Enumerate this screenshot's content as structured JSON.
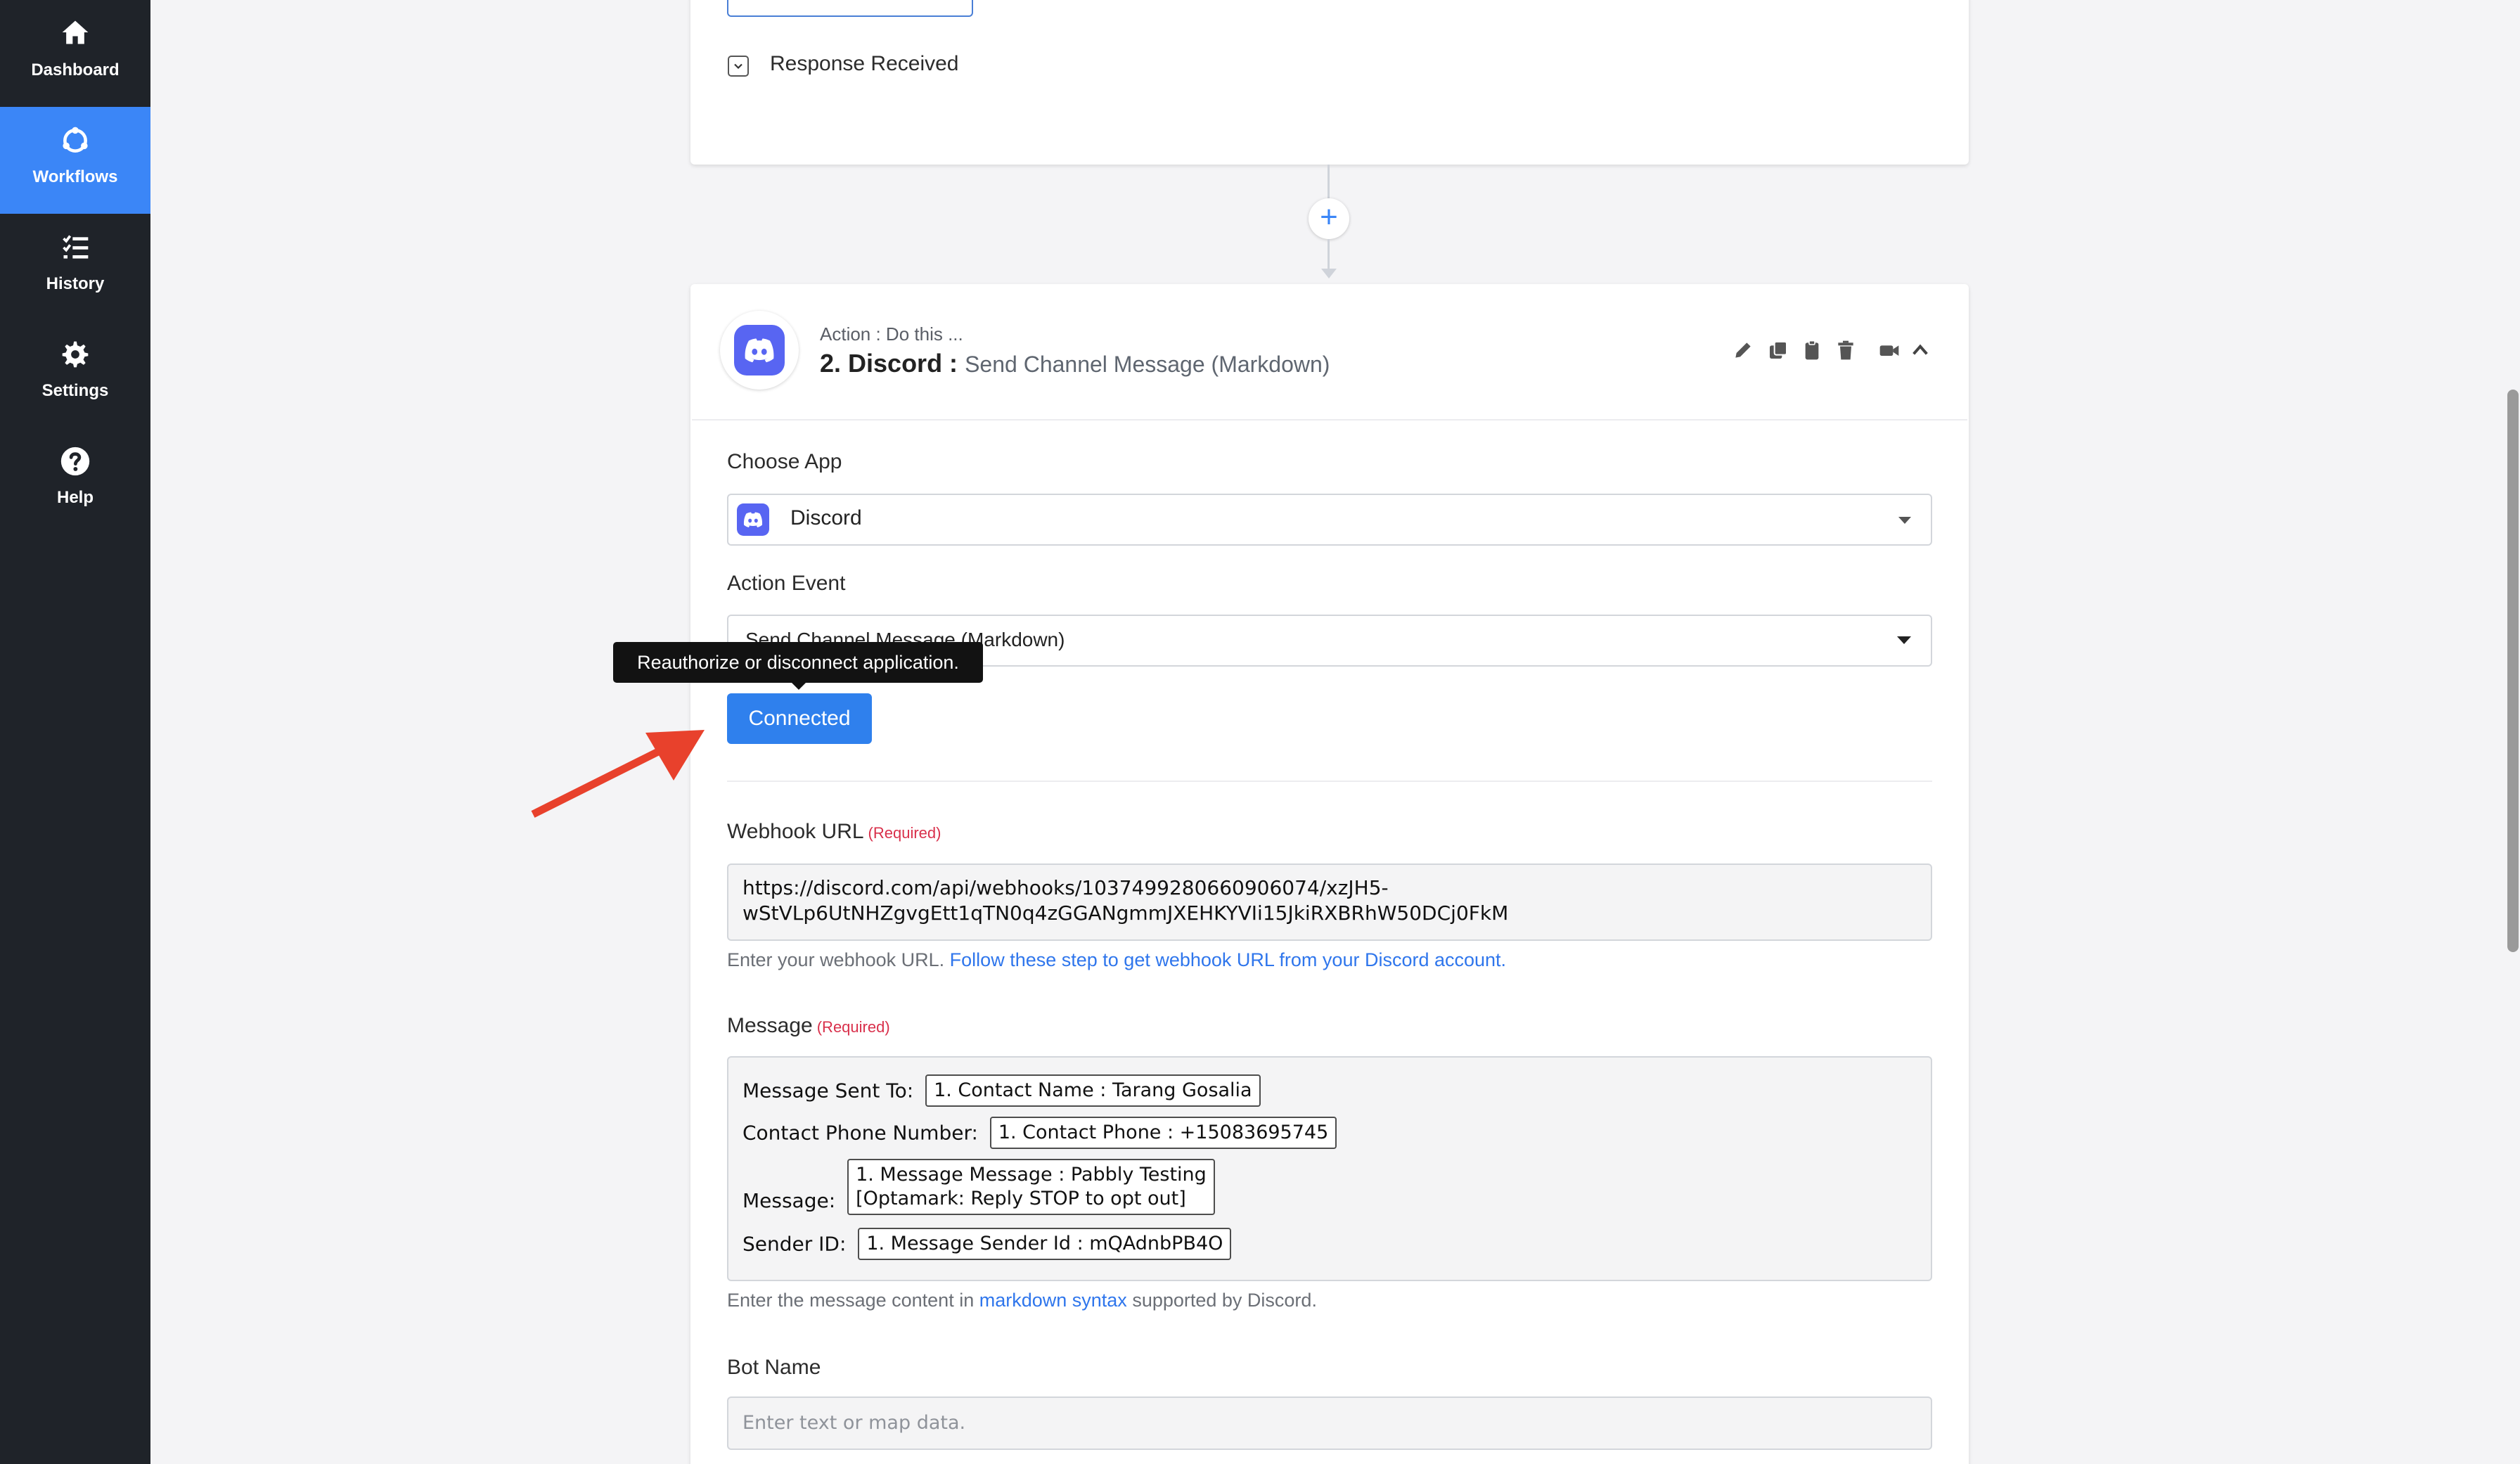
{
  "sidebar": {
    "items": [
      {
        "label": "Dashboard",
        "icon": "home-icon",
        "active": false
      },
      {
        "label": "Workflows",
        "icon": "workflows-icon",
        "active": true
      },
      {
        "label": "History",
        "icon": "history-icon",
        "active": false
      },
      {
        "label": "Settings",
        "icon": "gear-icon",
        "active": false
      },
      {
        "label": "Help",
        "icon": "help-icon",
        "active": false
      }
    ]
  },
  "trigger_card": {
    "response_received_label": "Response Received"
  },
  "action_card": {
    "subtitle": "Action : Do this ...",
    "step_title": "2. Discord :",
    "step_event": "Send Channel Message (Markdown)",
    "choose_app_label": "Choose App",
    "choose_app_value": "Discord",
    "action_event_label": "Action Event",
    "action_event_value": "Send Channel Message (Markdown)",
    "tooltip": "Reauthorize or disconnect application.",
    "connected_label": "Connected",
    "webhook": {
      "label": "Webhook URL",
      "required": "(Required)",
      "value_line1": "https://discord.com/api/webhooks/1037499280660906074/xzJH5-",
      "value_line2": "wStVLp6UtNHZgvgEtt1qTN0q4zGGANgmmJXEHKYVIi15JkiRXBRhW50DCj0FkM",
      "help_prefix": "Enter your webhook URL. ",
      "help_link": "Follow these step to get webhook URL from your Discord account."
    },
    "message": {
      "label": "Message",
      "required": "(Required)",
      "rows": [
        {
          "prefix": "Message Sent To:",
          "tag": "1. Contact Name : Tarang Gosalia"
        },
        {
          "prefix": "Contact Phone Number:",
          "tag": "1. Contact Phone : +15083695745"
        },
        {
          "prefix": "Message:",
          "tag_line1": "1. Message Message : Pabbly Testing",
          "tag_line2": "[Optamark: Reply STOP to opt out]"
        },
        {
          "prefix": "Sender ID:",
          "tag": "1. Message Sender Id : mQAdnbPB4O"
        }
      ],
      "help_prefix": "Enter the message content in ",
      "help_link": "markdown syntax",
      "help_suffix": " supported by Discord."
    },
    "bot_name": {
      "label": "Bot Name",
      "placeholder": "Enter text or map data."
    }
  },
  "colors": {
    "sidebar_bg": "#1f2329",
    "active_nav": "#3b86f7",
    "primary_button": "#2f80ed",
    "required": "#d9304b",
    "discord": "#5865f2",
    "annotation_arrow": "#e8412c"
  }
}
